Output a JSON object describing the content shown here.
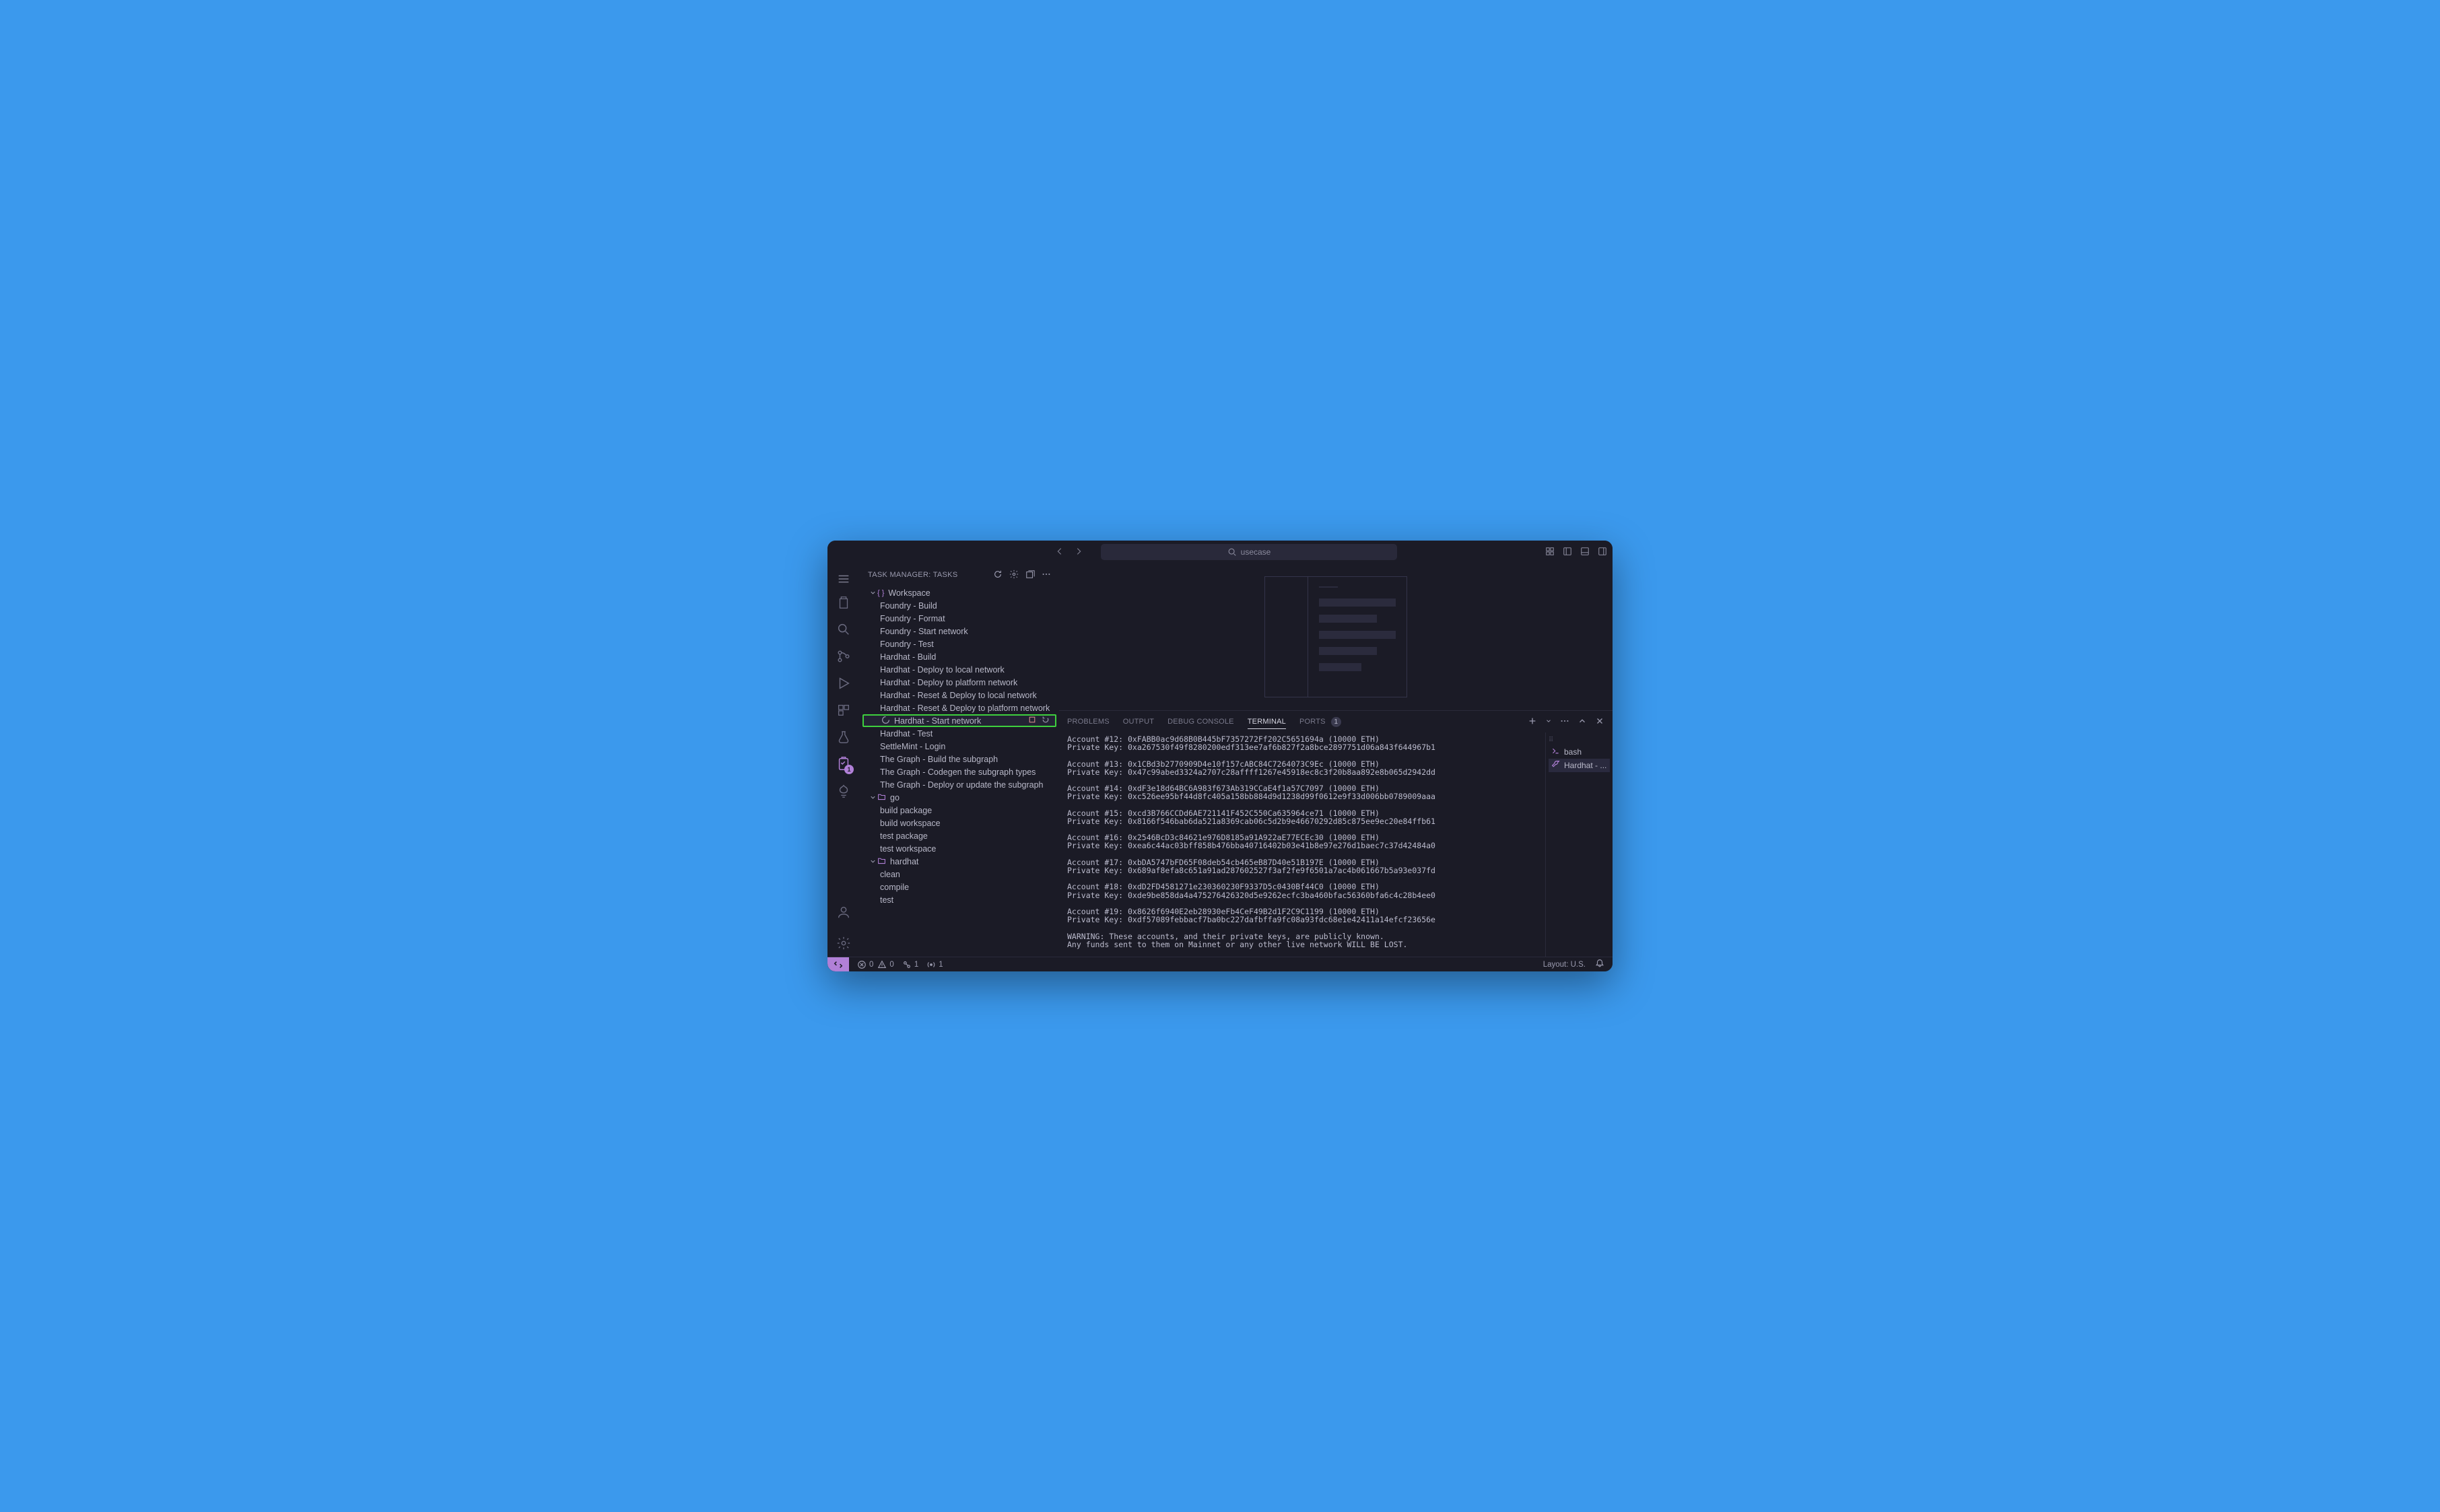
{
  "search": {
    "placeholder": "usecase"
  },
  "sidebar": {
    "title": "TASK MANAGER: TASKS",
    "groups": [
      {
        "name": "Workspace",
        "icon": "braces",
        "items": [
          "Foundry - Build",
          "Foundry - Format",
          "Foundry - Start network",
          "Foundry - Test",
          "Hardhat - Build",
          "Hardhat - Deploy to local network",
          "Hardhat - Deploy to platform network",
          "Hardhat - Reset & Deploy to local network",
          "Hardhat - Reset & Deploy to platform network",
          "Hardhat - Start network",
          "Hardhat - Test",
          "SettleMint - Login",
          "The Graph - Build the subgraph",
          "The Graph - Codegen the subgraph types",
          "The Graph - Deploy or update the subgraph"
        ],
        "highlighted_index": 9
      },
      {
        "name": "go",
        "icon": "folder",
        "items": [
          "build package",
          "build workspace",
          "test package",
          "test workspace"
        ]
      },
      {
        "name": "hardhat",
        "icon": "folder",
        "items": [
          "clean",
          "compile",
          "test"
        ]
      }
    ]
  },
  "panel": {
    "tabs": {
      "problems": "PROBLEMS",
      "output": "OUTPUT",
      "debug": "DEBUG CONSOLE",
      "terminal": "TERMINAL",
      "ports": "PORTS",
      "ports_badge": "1"
    },
    "terminals": [
      {
        "label": "bash",
        "icon": "bash"
      },
      {
        "label": "Hardhat - ...",
        "icon": "tools"
      }
    ]
  },
  "terminal_lines": [
    "Account #12: 0xFABB0ac9d68B0B445bF7357272Ff202C5651694a (10000 ETH)",
    "Private Key: 0xa267530f49f8280200edf313ee7af6b827f2a8bce2897751d06a843f644967b1",
    "",
    "Account #13: 0x1CBd3b2770909D4e10f157cABC84C7264073C9Ec (10000 ETH)",
    "Private Key: 0x47c99abed3324a2707c28affff1267e45918ec8c3f20b8aa892e8b065d2942dd",
    "",
    "Account #14: 0xdF3e18d64BC6A983f673Ab319CCaE4f1a57C7097 (10000 ETH)",
    "Private Key: 0xc526ee95bf44d8fc405a158bb884d9d1238d99f0612e9f33d006bb0789009aaa",
    "",
    "Account #15: 0xcd3B766CCDd6AE721141F452C550Ca635964ce71 (10000 ETH)",
    "Private Key: 0x8166f546bab6da521a8369cab06c5d2b9e46670292d85c875ee9ec20e84ffb61",
    "",
    "Account #16: 0x2546BcD3c84621e976D8185a91A922aE77ECEc30 (10000 ETH)",
    "Private Key: 0xea6c44ac03bff858b476bba40716402b03e41b8e97e276d1baec7c37d42484a0",
    "",
    "Account #17: 0xbDA5747bFD65F08deb54cb465eB87D40e51B197E (10000 ETH)",
    "Private Key: 0x689af8efa8c651a91ad287602527f3af2fe9f6501a7ac4b061667b5a93e037fd",
    "",
    "Account #18: 0xdD2FD4581271e230360230F9337D5c0430Bf44C0 (10000 ETH)",
    "Private Key: 0xde9be858da4a475276426320d5e9262ecfc3ba460bfac56360bfa6c4c28b4ee0",
    "",
    "Account #19: 0x8626f6940E2eb28930eFb4CeF49B2d1F2C9C1199 (10000 ETH)",
    "Private Key: 0xdf57089febbacf7ba0bc227dafbffa9fc08a93fdc68e1e42411a14efcf23656e",
    "",
    "WARNING: These accounts, and their private keys, are publicly known.",
    "Any funds sent to them on Mainnet or any other live network WILL BE LOST."
  ],
  "statusbar": {
    "errors": "0",
    "warnings": "0",
    "ports": "1",
    "radio": "1",
    "layout": "Layout: U.S."
  }
}
